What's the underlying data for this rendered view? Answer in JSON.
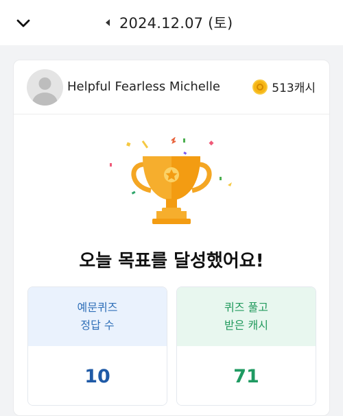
{
  "header": {
    "date": "2024.12.07 (토)"
  },
  "profile": {
    "name": "Helpful Fearless Michelle",
    "cash": "513캐시"
  },
  "result": {
    "headline": "오늘 목표를 달성했어요!"
  },
  "stats": [
    {
      "label_line1": "예문퀴즈",
      "label_line2": "정답 수",
      "value": "10"
    },
    {
      "label_line1": "퀴즈 풀고",
      "label_line2": "받은 캐시",
      "value": "71"
    }
  ],
  "colors": {
    "trophy": "#f4a623",
    "quiz_blue": "#2f6fb8",
    "cash_green": "#229a5d"
  }
}
